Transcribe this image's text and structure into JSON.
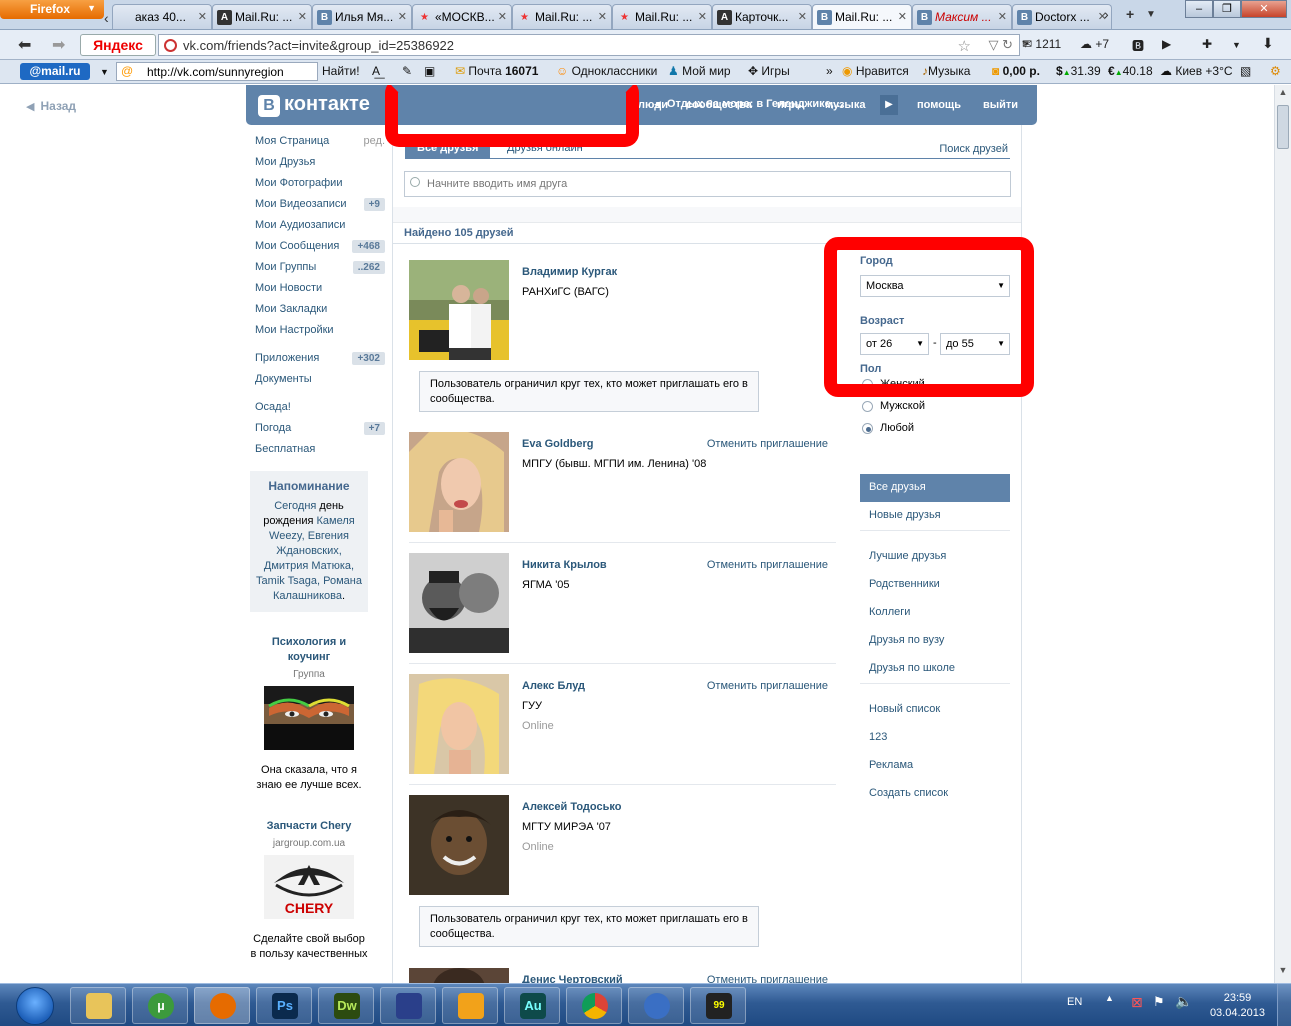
{
  "browser": {
    "menu_button": "Firefox",
    "tabs": [
      {
        "label": "аказ 40...",
        "icon": ""
      },
      {
        "label": "Mail.Ru: ...",
        "icon": "A"
      },
      {
        "label": "Илья Мя...",
        "icon": "B"
      },
      {
        "label": "«МОСКВ...",
        "icon": "★"
      },
      {
        "label": "Mail.Ru: ...",
        "icon": "★"
      },
      {
        "label": "Mail.Ru: ...",
        "icon": "★"
      },
      {
        "label": "Карточк...",
        "icon": "A"
      },
      {
        "label": "Mail.Ru: ...",
        "icon": "B"
      },
      {
        "label": "Максим ...",
        "icon": "B"
      },
      {
        "label": "Doctorx ...",
        "icon": "B"
      }
    ],
    "yandex": "Яндекс",
    "url": "vk.com/friends?act=invite&group_id=25386922",
    "mail_count": "1211",
    "weather_temp": "+7",
    "bookmarks": {
      "mailru": "@mail.ru",
      "search_value": "http://vk.com/sunnyregion",
      "find": "Найти!",
      "mail_label": "Почта",
      "mail_num": "16071",
      "odnoklassniki": "Одноклассники",
      "moy_mir": "Мой мир",
      "igry": "Игры",
      "more": "»",
      "nravitsya": "Нравится",
      "muzyka": "Музыка",
      "balance": "0,00 р.",
      "usd": "31.39",
      "eur": "40.18",
      "weather": "Киев +3°C"
    }
  },
  "page": {
    "back": "Назад",
    "header": {
      "logo": "контакте",
      "logo_b": "В",
      "status": "Отдых на море: в Геленджике,...",
      "menu": [
        "люди",
        "сообщества",
        "игры",
        "музыка",
        "помощь",
        "выйти"
      ]
    },
    "left_menu": [
      {
        "label": "Моя Страница",
        "extra": "ред."
      },
      {
        "label": "Мои Друзья",
        "extra": ""
      },
      {
        "label": "Мои Фотографии",
        "extra": ""
      },
      {
        "label": "Мои Видеозаписи",
        "extra": "+9"
      },
      {
        "label": "Мои Аудиозаписи",
        "extra": ""
      },
      {
        "label": "Мои Сообщения",
        "extra": "+468"
      },
      {
        "label": "Мои Группы",
        "extra": "..262"
      },
      {
        "label": "Мои Новости",
        "extra": ""
      },
      {
        "label": "Мои Закладки",
        "extra": ""
      },
      {
        "label": "Мои Настройки",
        "extra": ""
      },
      {
        "label": "Приложения",
        "extra": "+302"
      },
      {
        "label": "Документы",
        "extra": ""
      },
      {
        "label": "Осада!",
        "extra": ""
      },
      {
        "label": "Погода",
        "extra": "+7"
      },
      {
        "label": "Бесплатная",
        "extra": ""
      }
    ],
    "reminder": {
      "title": "Напоминание",
      "t1": "Сегодня",
      "t2": " день рождения ",
      "t3": "Камеля Weezy, Евгения Ждановских, Дмитрия Матюка, Tamik Tsaga, Романа Калашникова",
      "t4": "."
    },
    "ad1": {
      "title": "Психология и коучинг",
      "sub": "Группа",
      "text": "Она сказала, что я знаю ее лучше всех."
    },
    "ad2": {
      "title": "Запчасти Chery",
      "sub": "jargroup.com.ua",
      "brand": "CHERY",
      "text": "Сделайте свой выбор в пользу качественных"
    },
    "tabs": {
      "all": "Все друзья",
      "online": "Друзья онлайн",
      "find": "Поиск друзей"
    },
    "search_placeholder": "Начните вводить имя друга",
    "found": "Найдено 105 друзей",
    "restricted_note": "Пользователь ограничил круг тех, кто может приглашать его в сообщества.",
    "cancel_invite": "Отменить приглашение",
    "friends": [
      {
        "name": "Владимир Кургак",
        "edu": "РАНХиГС (ВАГС)",
        "online": ""
      },
      {
        "name": "Eva Goldberg",
        "edu": "МПГУ (бывш. МГПИ им. Ленина) '08",
        "online": ""
      },
      {
        "name": "Никита Крылов",
        "edu": "ЯГМА '05",
        "online": ""
      },
      {
        "name": "Алекс Блуд",
        "edu": "ГУУ",
        "online": "Online"
      },
      {
        "name": "Алексей Тодосько",
        "edu": "МГТУ МИРЭА '07",
        "online": "Online"
      },
      {
        "name": "Денис Чертовский",
        "edu": "",
        "online": ""
      }
    ],
    "filters": {
      "city_label": "Город",
      "city": "Москва",
      "age_label": "Возраст",
      "age_from": "от 26",
      "age_dash": "-",
      "age_to": "до 55",
      "gender_label": "Пол",
      "genders": [
        "Женский",
        "Мужской",
        "Любой"
      ]
    },
    "lists": {
      "group1": [
        "Все друзья",
        "Новые друзья"
      ],
      "group2": [
        "Лучшие друзья",
        "Родственники",
        "Коллеги",
        "Друзья по вузу",
        "Друзья по школе"
      ],
      "group3": [
        "Новый список",
        "123",
        "Реклама",
        "Создать список"
      ]
    }
  },
  "taskbar": {
    "apps": [
      "explorer",
      "utorrent",
      "firefox",
      "Ps",
      "Dw",
      "save",
      "fl-studio",
      "Au",
      "chrome",
      "app",
      "99"
    ],
    "lang": "EN",
    "time": "23:59",
    "date": "03.04.2013"
  },
  "colors": {
    "vk_blue": "#5f83aa",
    "vk_link": "#2b587a",
    "highlight_red": "#ff0000"
  }
}
